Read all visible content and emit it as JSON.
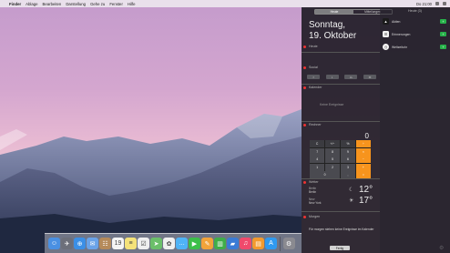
{
  "menubar": {
    "apple_glyph": "",
    "items": [
      "Finder",
      "Ablage",
      "Bearbeiten",
      "Darstellung",
      "Gehe zu",
      "Fenster",
      "Hilfe"
    ],
    "time": "Do 21:00"
  },
  "notification_center": {
    "tabs": [
      "Heute",
      "Mitteilungen"
    ],
    "active_tab": "Heute",
    "day": "Sonntag,",
    "date": "19. Oktober",
    "widgets": {
      "today_label": "Heute",
      "social_label": "Social",
      "calendar_label": "Kalender",
      "calendar_text": "Keine Ereignisse",
      "calculator_label": "Rechner",
      "weather_label": "Wetter",
      "tomorrow_label": "Morgen"
    },
    "share_buttons": [
      "f",
      "t",
      "in",
      "✉"
    ],
    "calculator": {
      "display": "0",
      "keys": [
        {
          "label": "C",
          "kind": "fn"
        },
        {
          "label": "+/−",
          "kind": "fn"
        },
        {
          "label": "%",
          "kind": "fn"
        },
        {
          "label": "÷",
          "kind": "op"
        },
        {
          "label": "7",
          "kind": "num"
        },
        {
          "label": "8",
          "kind": "num"
        },
        {
          "label": "9",
          "kind": "num"
        },
        {
          "label": "×",
          "kind": "op"
        },
        {
          "label": "4",
          "kind": "num"
        },
        {
          "label": "5",
          "kind": "num"
        },
        {
          "label": "6",
          "kind": "num"
        },
        {
          "label": "−",
          "kind": "op"
        },
        {
          "label": "1",
          "kind": "num"
        },
        {
          "label": "2",
          "kind": "num"
        },
        {
          "label": "3",
          "kind": "num"
        },
        {
          "label": "+",
          "kind": "op"
        },
        {
          "label": "0",
          "kind": "num",
          "wide": true
        },
        {
          "label": ",",
          "kind": "num"
        },
        {
          "label": "=",
          "kind": "op"
        }
      ]
    },
    "weather": [
      {
        "line1": "Berlin",
        "line2": "Berlin",
        "condition_icon": "moon-icon",
        "glyph": "☾",
        "temp": "12°"
      },
      {
        "line1": "New",
        "line2": "New York",
        "condition_icon": "sun-icon",
        "glyph": "☀",
        "temp": "17°"
      }
    ],
    "tomorrow_text": "Für morgen stehen keine Ereignisse im Kalender",
    "edit_label": "Fertig",
    "notifications_title": "Heute (3)",
    "notifications": [
      {
        "label": "Aktien",
        "icon": "stocks-icon",
        "color": "#1b1b1b",
        "glyph": "▲"
      },
      {
        "label": "Erinnerungen",
        "icon": "reminders-icon",
        "color": "#f2f2f2",
        "glyph": "☰"
      },
      {
        "label": "Weltzeituhr",
        "icon": "world-clock-icon",
        "color": "#f5f5f5",
        "glyph": "◷"
      }
    ]
  },
  "dock": {
    "apps": [
      {
        "name": "finder-icon",
        "color": "#4a90e2",
        "glyph": "☺"
      },
      {
        "name": "launchpad-icon",
        "color": "#6c6f7a",
        "glyph": "✈"
      },
      {
        "name": "safari-icon",
        "color": "#3b8fe6",
        "glyph": "⊕"
      },
      {
        "name": "mail-icon",
        "color": "#6aa3e8",
        "glyph": "✉"
      },
      {
        "name": "contacts-icon",
        "color": "#b58a5a",
        "glyph": "☷"
      },
      {
        "name": "calendar-icon",
        "color": "#f4f4f4",
        "glyph": "19"
      },
      {
        "name": "notes-icon",
        "color": "#f4e27a",
        "glyph": "≡"
      },
      {
        "name": "reminders-icon",
        "color": "#efefef",
        "glyph": "☑"
      },
      {
        "name": "maps-icon",
        "color": "#6bbf6a",
        "glyph": "➤"
      },
      {
        "name": "photos-icon",
        "color": "#f0f0f0",
        "glyph": "✿"
      },
      {
        "name": "messages-icon",
        "color": "#4fb3f6",
        "glyph": "…"
      },
      {
        "name": "facetime-icon",
        "color": "#3cbf4a",
        "glyph": "▶"
      },
      {
        "name": "pages-icon",
        "color": "#f2a33a",
        "glyph": "✎"
      },
      {
        "name": "numbers-icon",
        "color": "#3fae49",
        "glyph": "▥"
      },
      {
        "name": "keynote-icon",
        "color": "#3a7bd5",
        "glyph": "▰"
      },
      {
        "name": "itunes-icon",
        "color": "#f04a6c",
        "glyph": "♫"
      },
      {
        "name": "ibooks-icon",
        "color": "#f29a2e",
        "glyph": "▤"
      },
      {
        "name": "app-store-icon",
        "color": "#2f9af0",
        "glyph": "A"
      },
      {
        "name": "system-preferences-icon",
        "color": "#8a8a90",
        "glyph": "⚙"
      }
    ]
  }
}
